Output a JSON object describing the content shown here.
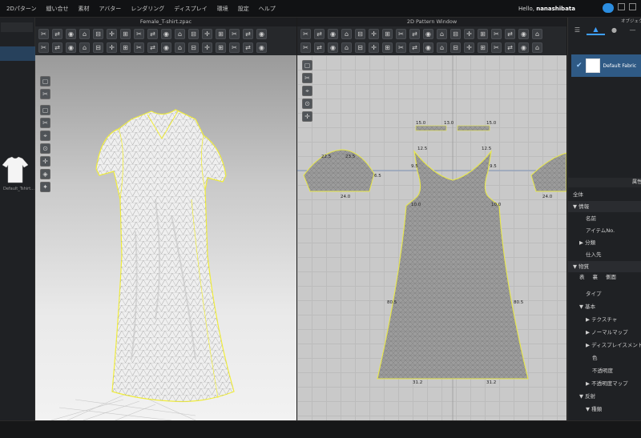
{
  "menubar": {
    "items": [
      "2Dパターン",
      "縫い合せ",
      "素材",
      "アバター",
      "レンダリング",
      "ディスプレイ",
      "環境",
      "設定",
      "ヘルプ"
    ],
    "greeting": "Hello,",
    "username": "nanashibata"
  },
  "library": {
    "item_label": "Default_Tshirt..."
  },
  "window3d": {
    "title": "Female_T-shirt.zpac"
  },
  "window2d": {
    "title": "2D Pattern Window",
    "measurements": {
      "sleeve_top_left": "15.0",
      "sleeve_top_mid": "13.0",
      "sleeve_top_right": "15.0",
      "neck_left": "12.5",
      "neck_right": "12.5",
      "shoulder_left": "9.5",
      "shoulder_right": "9.5",
      "armhole_left": "10.0",
      "armhole_right": "10.0",
      "side_left": "80.5",
      "side_right": "80.5",
      "hem_left": "31.2",
      "hem_right": "31.2",
      "sleeve_left_a": "23.5",
      "sleeve_left_b": "22.5",
      "sleeve_left_c": "6.5",
      "sleeve_left_bottom": "24.0",
      "sleeve_right_bottom": "24.0"
    }
  },
  "properties": {
    "object_browser_label": "オブジェクトブラウザ",
    "fabric_name": "Default Fabric",
    "panel_header": "属性",
    "rows": [
      {
        "label": "全体",
        "indent": 0,
        "section": false
      },
      {
        "label": "▼ 情報",
        "indent": 0,
        "section": true
      },
      {
        "label": "名前",
        "indent": 2,
        "section": false
      },
      {
        "label": "アイテムNo.",
        "indent": 2,
        "section": false
      },
      {
        "label": "▶ 分類",
        "indent": 1,
        "section": false
      },
      {
        "label": "仕入先",
        "indent": 2,
        "section": false
      },
      {
        "label": "▼ 物質",
        "indent": 0,
        "section": true
      }
    ],
    "subtabs": [
      "表",
      "裏",
      "側面"
    ],
    "rows2": [
      {
        "label": "タイプ",
        "indent": 2
      },
      {
        "label": "▼ 基本",
        "indent": 1
      },
      {
        "label": "▶ テクスチャ",
        "indent": 2
      },
      {
        "label": "▶ ノーマルマップ",
        "indent": 2
      },
      {
        "label": "▶ ディスプレイスメントマップ",
        "indent": 2
      },
      {
        "label": "色",
        "indent": 3
      },
      {
        "label": "不透明度",
        "indent": 3
      },
      {
        "label": "▶ 不透明度マップ",
        "indent": 2
      },
      {
        "label": "▼ 反射",
        "indent": 1
      },
      {
        "label": "▼ 種類",
        "indent": 2
      }
    ]
  },
  "colors": {
    "accent": "#3ea0ff",
    "outline": "#f3f06a",
    "bg": "#1b1b1b"
  }
}
